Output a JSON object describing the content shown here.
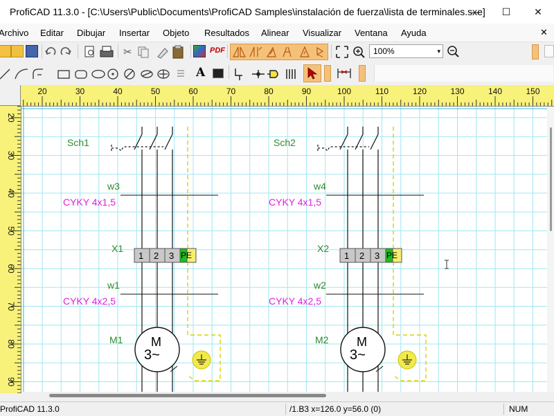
{
  "window": {
    "title": "ProfiCAD 11.3.0 - [C:\\Users\\Public\\Documents\\ProfiCAD Samples\\instalación de fuerza\\lista de terminales.sxe]",
    "minimize_glyph": "—",
    "maximize_glyph": "☐",
    "close_glyph": "✕"
  },
  "menu": {
    "items": [
      "Archivo",
      "Editar",
      "Dibujar",
      "Insertar",
      "Objeto",
      "Resultados",
      "Alinear",
      "Visualizar",
      "Ventana",
      "Ayuda"
    ],
    "close_glyph": "✕"
  },
  "toolbar": {
    "zoom_value": "100%",
    "zoom_arrow": "▾",
    "pdf_label": "PDF",
    "text_tool": "A"
  },
  "rulers": {
    "h_ticks": [
      "20",
      "30",
      "40",
      "50",
      "60",
      "70",
      "80",
      "90",
      "100",
      "110",
      "120",
      "130",
      "140",
      "150"
    ],
    "v_ticks": [
      "20",
      "30",
      "40",
      "50",
      "60",
      "70",
      "80",
      "90"
    ]
  },
  "drawing": {
    "units": [
      {
        "switch": "Sch1",
        "cable_top_name": "w3",
        "cable_top_type": "CYKY 4x1,5",
        "terminal": "X1",
        "terminal_labels": [
          "1",
          "2",
          "3",
          "PE"
        ],
        "cable_bottom_name": "w1",
        "cable_bottom_type": "CYKY 4x2,5",
        "motor": "M1",
        "motor_glyph_top": "M",
        "motor_glyph_bottom": "3~"
      },
      {
        "switch": "Sch2",
        "cable_top_name": "w4",
        "cable_top_type": "CYKY 4x1,5",
        "terminal": "X2",
        "terminal_labels": [
          "1",
          "2",
          "3",
          "PE"
        ],
        "cable_bottom_name": "w2",
        "cable_bottom_type": "CYKY 4x2,5",
        "motor": "M2",
        "motor_glyph_top": "M",
        "motor_glyph_bottom": "3~"
      }
    ],
    "colors": {
      "label_green": "#2e8b2e",
      "cable_magenta": "#e020e0",
      "grid_cyan": "#9fe7f3",
      "earth_yellow": "#f2ea4a",
      "pe_green": "#18c018"
    }
  },
  "statusbar": {
    "app": "ProfiCAD 11.3.0",
    "position": "/1.B3  x=126.0  y=56.0 (0)",
    "numlock": "NUM"
  }
}
